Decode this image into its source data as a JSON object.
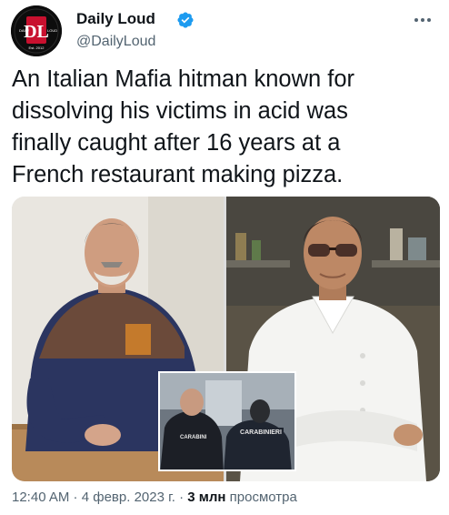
{
  "author": {
    "name": "Daily Loud",
    "handle": "@DailyLoud",
    "avatar_letters": "DL",
    "avatar_small_left": "DAILY",
    "avatar_small_right": "LOUD",
    "avatar_small_bottom": "Est. 2012",
    "verified": true
  },
  "tweet": {
    "text_lines": [
      "An Italian Mafia hitman known for",
      "dissolving his victims in acid was",
      "finally caught after 16 years at a",
      "French restaurant making pizza."
    ]
  },
  "media": {
    "inset_label": "CARABINIERI",
    "inset_badge": "CARABINI"
  },
  "meta": {
    "time": "12:40 AM",
    "sep1": " · ",
    "date": "4 февр. 2023 г.",
    "sep2": " · ",
    "views_count": "3 млн",
    "views_label": " просмотра"
  },
  "colors": {
    "text": "#0f1419",
    "secondary": "#536471",
    "verified": "#1d9bf0",
    "avatar_red": "#c8102e"
  },
  "icons": {
    "verified": "verified-badge-icon",
    "more": "more-options-icon"
  }
}
